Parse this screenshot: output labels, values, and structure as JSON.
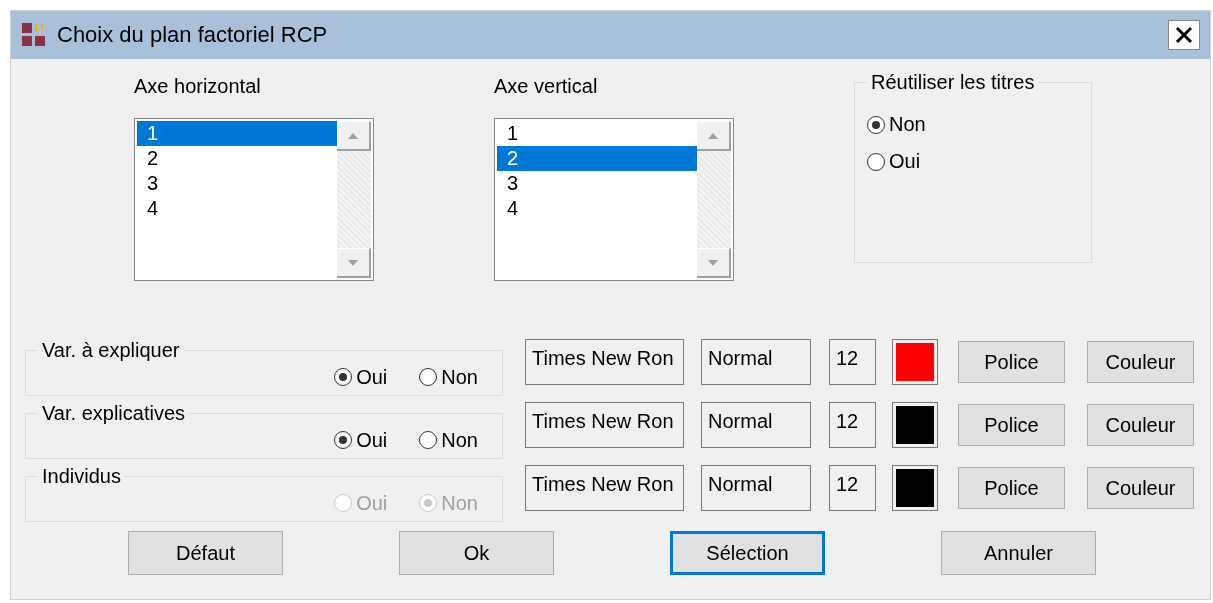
{
  "window": {
    "title": "Choix du plan factoriel RCP"
  },
  "axes": [
    {
      "label": "Axe horizontal",
      "items": [
        {
          "text": "1",
          "selected": true
        },
        {
          "text": "2",
          "selected": false
        },
        {
          "text": "3",
          "selected": false
        },
        {
          "text": "4",
          "selected": false
        }
      ]
    },
    {
      "label": "Axe vertical",
      "items": [
        {
          "text": "1",
          "selected": false
        },
        {
          "text": "2",
          "selected": true
        },
        {
          "text": "3",
          "selected": false
        },
        {
          "text": "4",
          "selected": false
        }
      ]
    }
  ],
  "reuse_titles": {
    "label": "Réutiliser les titres",
    "options": [
      {
        "label": "Non",
        "selected": true
      },
      {
        "label": "Oui",
        "selected": false
      }
    ]
  },
  "variables": [
    {
      "label": "Var. à expliquer",
      "disabled": false,
      "options": [
        {
          "label": "Oui",
          "selected": true
        },
        {
          "label": "Non",
          "selected": false
        }
      ],
      "font": "Times New Ron",
      "style": "Normal",
      "size": "12",
      "color": "#ff0000",
      "font_button": "Police",
      "color_button": "Couleur"
    },
    {
      "label": "Var. explicatives",
      "disabled": false,
      "options": [
        {
          "label": "Oui",
          "selected": true
        },
        {
          "label": "Non",
          "selected": false
        }
      ],
      "font": "Times New Ron",
      "style": "Normal",
      "size": "12",
      "color": "#000000",
      "font_button": "Police",
      "color_button": "Couleur"
    },
    {
      "label": "Individus",
      "disabled": true,
      "options": [
        {
          "label": "Oui",
          "selected": false
        },
        {
          "label": "Non",
          "selected": true
        }
      ],
      "font": "Times New Ron",
      "style": "Normal",
      "size": "12",
      "color": "#000000",
      "font_button": "Police",
      "color_button": "Couleur"
    }
  ],
  "buttons": [
    {
      "label": "Défaut",
      "focused": false
    },
    {
      "label": "Ok",
      "focused": false
    },
    {
      "label": "Sélection",
      "focused": true
    },
    {
      "label": "Annuler",
      "focused": false
    }
  ]
}
